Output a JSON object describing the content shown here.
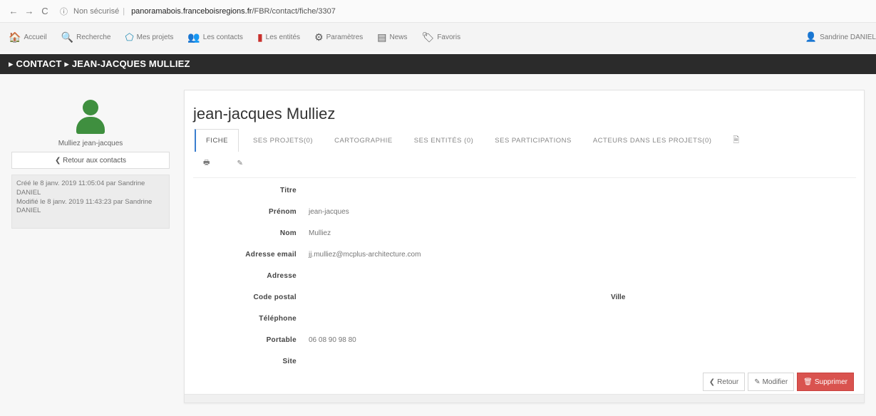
{
  "browser": {
    "back": "←",
    "forward": "→",
    "reload": "C",
    "info": "ⓘ",
    "insecure": "Non sécurisé",
    "separator": "|",
    "host": "panoramabois.franceboisregions.fr",
    "path": "/FBR/contact/fiche/3307"
  },
  "menu": {
    "items": [
      {
        "icon": "home-icon",
        "glyph": "🏠",
        "label": "Accueil"
      },
      {
        "icon": "search-icon",
        "glyph": "🔍",
        "label": "Recherche"
      },
      {
        "icon": "projects-icon",
        "glyph": "⬠",
        "label": "Mes projets"
      },
      {
        "icon": "contacts-icon",
        "glyph": "👥",
        "label": "Les contacts"
      },
      {
        "icon": "entities-icon",
        "glyph": "▮",
        "label": "Les entités"
      },
      {
        "icon": "settings-icon",
        "glyph": "⚙",
        "label": "Paramètres"
      },
      {
        "icon": "news-icon",
        "glyph": "▤",
        "label": "News"
      },
      {
        "icon": "favorites-icon",
        "glyph": "🏷",
        "label": "Favoris"
      }
    ],
    "user": "Sandrine DANIEL",
    "user_glyph": "👤"
  },
  "colors": {
    "accent_green": "#3f8f3f",
    "breadcrumb_bg": "#2b2b2b",
    "danger": "#d9534f",
    "tab_active_border": "#3a7ecf"
  },
  "breadcrumb": "▸ CONTACT ▸ JEAN-JACQUES MULLIEZ",
  "left": {
    "avatar_icon": "user-icon",
    "name": "Mulliez jean-jacques",
    "back_label": "❮ Retour aux contacts",
    "audit_line1": "Créé le 8 janv. 2019 11:05:04 par Sandrine DANIEL",
    "audit_line2": "Modifié le 8 janv. 2019 11:43:23 par Sandrine DANIEL"
  },
  "card": {
    "title": "jean-jacques Mulliez",
    "tabs": [
      "FICHE",
      "SES PROJETS(0)",
      "CARTOGRAPHIE",
      "SES ENTITÉS (0)",
      "SES PARTICIPATIONS",
      "ACTEURS DANS LES PROJETS(0)"
    ],
    "tab_extra_icon": "🗎",
    "print_icon": "🖶",
    "tag_icon": "✎",
    "fields": [
      {
        "label": "Titre",
        "value": ""
      },
      {
        "label": "Prénom",
        "value": "jean-jacques"
      },
      {
        "label": "Nom",
        "value": "Mulliez"
      },
      {
        "label": "Adresse email",
        "value": "jj.mulliez@mcplus-architecture.com"
      },
      {
        "label": "Adresse",
        "value": ""
      },
      {
        "label": "Code postal",
        "value": ""
      },
      {
        "label": "Téléphone",
        "value": ""
      },
      {
        "label": "Portable",
        "value": "06 08 90 98 80"
      },
      {
        "label": "Site",
        "value": ""
      }
    ],
    "ville_label": "Ville",
    "buttons": {
      "back": "Retour",
      "back_glyph": "❮",
      "edit": "Modifier",
      "edit_glyph": "✎",
      "delete": "Supprimer",
      "delete_glyph": "🗑"
    }
  }
}
